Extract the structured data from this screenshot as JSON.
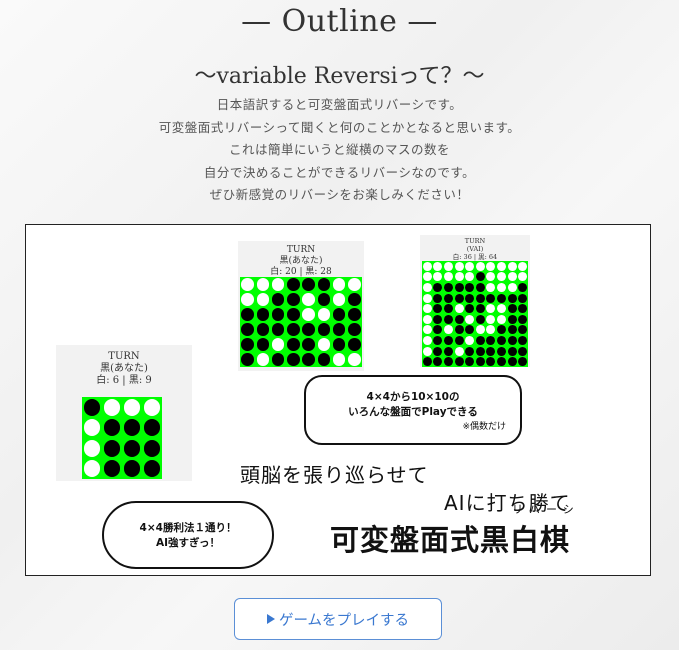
{
  "header": {
    "title": "— Outline —",
    "subtitle": "〜variable Reversiって？〜"
  },
  "description": [
    "日本語訳すると可変盤面式リバーシです。",
    "可変盤面式リバーシって聞くと何のことかとなると思います。",
    "これは簡単にいうと縦横のマスの数を",
    "自分で決めることができるリバーシなのです。",
    "ぜひ新感覚のリバーシをお楽しみください！"
  ],
  "banner": {
    "board_small": {
      "turn": "TURN",
      "player": "黒(あなた)",
      "score": "白: 6 | 黒: 9",
      "rows": [
        "BWWW",
        "WBBB",
        "WBBB",
        "WBBB"
      ]
    },
    "board_mid": {
      "turn": "TURN",
      "player": "黒(あなた)",
      "score": "白: 20 | 黒: 28",
      "rows": [
        "WWWBBBWW",
        "WWBBWBWB",
        "BBBBWWBB",
        "BBBBBBBB",
        "BBWBBWBB",
        "BWBBBBWW"
      ]
    },
    "board_large": {
      "turn": "TURN",
      "player": "(VAI)",
      "score": "白: 36 | 黒: 64",
      "rows": [
        "WWWWWWWWWW",
        "WWWWWBWWWW",
        "WBBBBBWWWB",
        "WBBBBBBBBB",
        "WBBWBBWWBB",
        "WBBBWBWWBB",
        "WBWBBWWBBB",
        "WBBBWBBBBB",
        "WBBWBBBBBB",
        "BBBBBBBBBB"
      ]
    },
    "bubble_sizes": {
      "line1": "4×4から10×10の",
      "line2": "いろんな盤面でPlayできる",
      "note": "※偶数だけ"
    },
    "bubble_win": {
      "line1": "4×4勝利法１通り！",
      "line2": "AI強すぎっ！"
    },
    "catch_line1": "頭脳を張り巡らせて",
    "catch_line2": "AIに打ち勝て",
    "logo_ruby": "リバーシ",
    "logo_title": "可変盤面式黒白棋"
  },
  "play_button": {
    "label": "ゲームをプレイする",
    "icon": "play-triangle-icon"
  },
  "colors": {
    "board_green": "#00ff00",
    "button_blue": "#3a78d0"
  }
}
